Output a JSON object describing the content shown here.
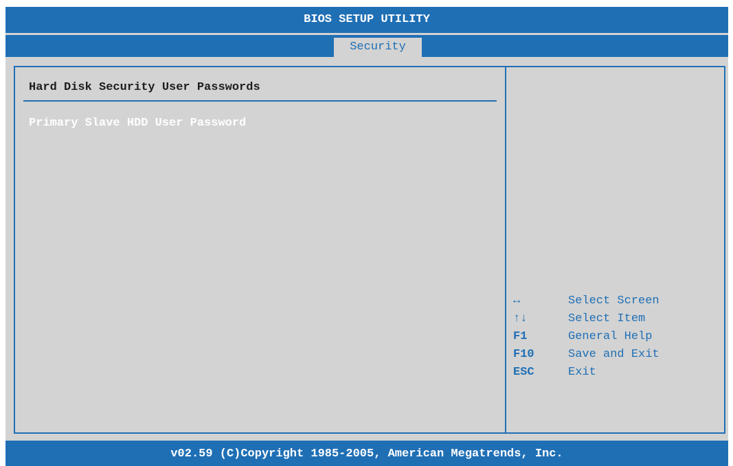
{
  "header": {
    "title": "BIOS SETUP UTILITY",
    "active_tab": "Security"
  },
  "main": {
    "section_title": "Hard Disk Security User Passwords",
    "items": [
      {
        "label": "Primary Slave HDD User Password"
      }
    ]
  },
  "help": {
    "keys": [
      {
        "key": "↔",
        "key_icon": "left-right-arrow-icon",
        "desc": "Select Screen"
      },
      {
        "key": "↑↓",
        "key_icon": "up-down-arrow-icon",
        "desc": "Select Item"
      },
      {
        "key": "F1",
        "desc": "General Help"
      },
      {
        "key": "F10",
        "desc": "Save and Exit"
      },
      {
        "key": "ESC",
        "desc": "Exit"
      }
    ]
  },
  "footer": {
    "copyright": "v02.59 (C)Copyright 1985-2005, American Megatrends, Inc."
  },
  "colors": {
    "bios_blue": "#1f6fb5",
    "panel_gray": "#d3d3d3",
    "highlight_text": "#ffffff",
    "normal_text": "#1e1e1e"
  }
}
